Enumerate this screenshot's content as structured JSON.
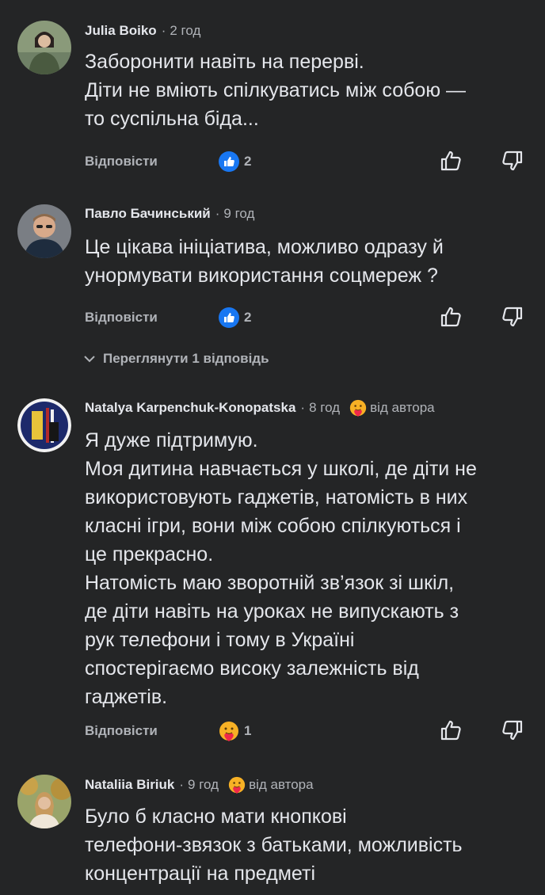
{
  "comments": [
    {
      "author": "Julia Boiko",
      "time": "2 год",
      "lines": [
        "Заборонити навіть на перерві.",
        "Діти не вміють спілкуватись між собою —",
        "то суспільна біда..."
      ],
      "reply_label": "Відповісти",
      "reaction_icon": "like-icon",
      "reaction_count": "2"
    },
    {
      "author": "Павло Бачинський",
      "time": "9 год",
      "lines": [
        "Це цікава ініціатива, можливо одразу й",
        "унормувати використання соцмереж ?"
      ],
      "reply_label": "Відповісти",
      "reaction_icon": "like-icon",
      "reaction_count": "2",
      "view_replies": "Переглянути 1 відповідь"
    },
    {
      "author": "Natalya Karpenchuk-Konopatska",
      "time": "8 год",
      "author_like_label": "від автора",
      "lines": [
        "Я дуже підтримую.",
        "Моя дитина навчається у школі, де діти не",
        "використовують гаджетів, натомість в них",
        "класні ігри, вони між собою спілкуються і",
        "це прекрасно.",
        "Натомість маю зворотній зв’язок зі шкіл,",
        "де діти навіть на уроках не випускають з",
        "рук телефони і тому в Україні",
        "спостерігаємо високу залежність від",
        "гаджетів."
      ],
      "reply_label": "Відповісти",
      "reaction_icon": "care-icon",
      "reaction_count": "1"
    },
    {
      "author": "Nataliia Biriuk",
      "time": "9 год",
      "author_like_label": "від автора",
      "lines": [
        "Було б класно мати кнопкові",
        "телефони-звязок з батьками, можливість",
        "концентрації на предметі"
      ]
    }
  ],
  "colors": {
    "background": "#242526",
    "text_primary": "#e4e6eb",
    "text_secondary": "#b0b3b8",
    "like_blue": "#1877f2",
    "care_yellow": "#f7b125"
  }
}
